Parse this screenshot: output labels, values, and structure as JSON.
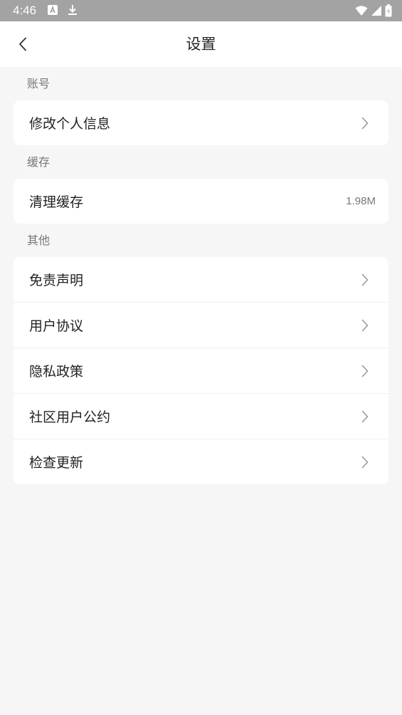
{
  "status_bar": {
    "time": "4:46"
  },
  "header": {
    "title": "设置"
  },
  "sections": {
    "account": {
      "label": "账号",
      "items": [
        {
          "label": "修改个人信息"
        }
      ]
    },
    "cache": {
      "label": "缓存",
      "items": [
        {
          "label": "清理缓存",
          "value": "1.98M"
        }
      ]
    },
    "other": {
      "label": "其他",
      "items": [
        {
          "label": "免责声明"
        },
        {
          "label": "用户协议"
        },
        {
          "label": "隐私政策"
        },
        {
          "label": "社区用户公约"
        },
        {
          "label": "检查更新"
        }
      ]
    }
  },
  "icons": {
    "back": "chevron-left-icon",
    "row_arrow": "chevron-right-icon",
    "wifi": "wifi-icon",
    "signal": "signal-icon",
    "battery": "battery-icon",
    "notification": "app-notification-icon",
    "download": "download-icon"
  },
  "colors": {
    "status_bar": "#a3a3a3",
    "background": "#f6f6f6",
    "card": "#ffffff",
    "chevron": "#999999"
  }
}
